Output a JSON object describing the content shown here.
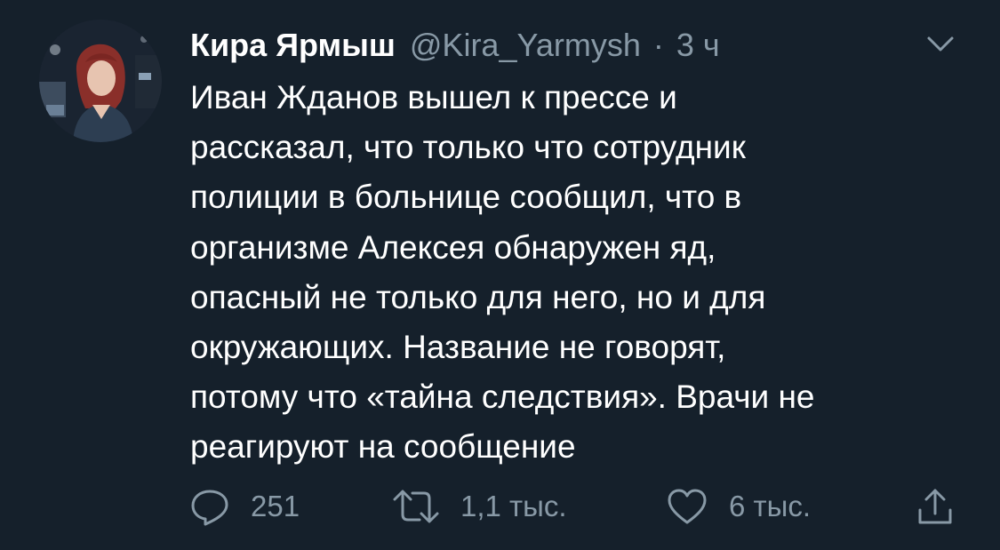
{
  "tweet": {
    "author_name": "Кира Ярмыш",
    "handle": "@Kira_Yarmysh",
    "separator": "·",
    "time": "3 ч",
    "text_lines": [
      "Иван Жданов вышел к прессе и",
      "рассказал, что только что сотрудник",
      "полиции в больнице сообщил, что в",
      "организме Алексея обнаружен яд,",
      "опасный не только для него, но и для",
      "окружающих. Название не говорят,",
      "потому что «тайна следствия». Врачи не",
      "реагируют на сообщение"
    ]
  },
  "actions": {
    "reply_count": "251",
    "retweet_count": "1,1 тыс.",
    "like_count": "6 тыс."
  },
  "icons": {
    "menu": "chevron-down-icon",
    "reply": "reply-icon",
    "retweet": "retweet-icon",
    "like": "heart-icon",
    "share": "share-icon"
  },
  "colors": {
    "background": "#15202b",
    "text": "#ffffff",
    "muted": "#8899a6"
  }
}
